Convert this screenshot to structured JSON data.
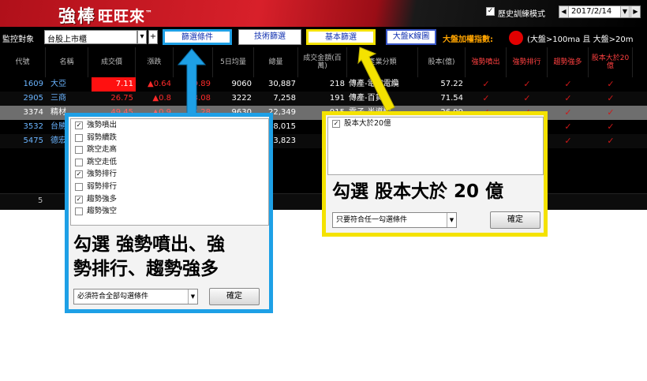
{
  "header": {
    "logo": "強棒",
    "logo_sub": "旺旺來",
    "logo_tm": "™",
    "history_mode_label": "歷史訓練模式",
    "history_mode_checked": true,
    "date": "2017/2/14",
    "prev_icon": "◀",
    "next_icon": "▶",
    "dropdown_icon": "▼"
  },
  "toolbar": {
    "monitor_label": "監控對象",
    "market_select": "台股上市櫃",
    "arrow_down": "▾",
    "plus": "+",
    "filter_btn": "篩選條件",
    "tech_btn": "技術篩選",
    "basic_btn": "基本篩選",
    "kline_btn": "大盤K線圖",
    "index_label": "大盤加權指數:",
    "condition_text": "(大盤>100ma 且 大盤>20m"
  },
  "table": {
    "headers": [
      "代號",
      "名稱",
      "成交價",
      "漲跌",
      "漲幅",
      "5日均量",
      "總量",
      "成交金額(百萬)",
      "產業分類",
      "股本(億)",
      "強勢噴出",
      "強勢排行",
      "趨勢強多",
      "股本大於20億"
    ],
    "rows": [
      {
        "code": "1609",
        "name": "大亞",
        "price": "7.11",
        "change": "▲0.64",
        "pct": "9.89",
        "avg5": "9060",
        "vol": "30,887",
        "amt": "218",
        "ind": "傳產-電線電纜",
        "cap": "57.22",
        "c1": "✓",
        "c2": "✓",
        "c3": "✓",
        "c4": "✓"
      },
      {
        "code": "2905",
        "name": "三商",
        "price": "26.75",
        "change": "▲0.8",
        "pct": "3.08",
        "avg5": "3222",
        "vol": "7,258",
        "amt": "191",
        "ind": "傳產-百貨",
        "cap": "71.54",
        "c1": "✓",
        "c2": "✓",
        "c3": "✓",
        "c4": "✓"
      },
      {
        "code": "3374",
        "name": "精材",
        "price": "49.45",
        "change": "▲0.9",
        "pct": "2.28",
        "avg5": "9630",
        "vol": "22,349",
        "amt": "915",
        "ind": "電子-半導體",
        "cap": "26.99",
        "c1": "✓",
        "c2": "✓",
        "c3": "✓",
        "c4": "✓"
      },
      {
        "code": "3532",
        "name": "台勝科",
        "price": "",
        "change": "",
        "pct": "",
        "avg5": "",
        "vol": "18,015",
        "amt": "",
        "ind": "",
        "cap": "",
        "c1": "✓",
        "c2": "✓",
        "c3": "✓",
        "c4": "✓"
      },
      {
        "code": "5475",
        "name": "德宏",
        "price": "",
        "change": "",
        "pct": "",
        "avg5": "",
        "vol": "3,823",
        "amt": "",
        "ind": "",
        "cap": "",
        "c1": "✓",
        "c2": "✓",
        "c3": "✓",
        "c4": "✓"
      }
    ],
    "row_count": "5"
  },
  "popup_left": {
    "options": [
      {
        "label": "強勢噴出",
        "checked": true
      },
      {
        "label": "弱勢續跌",
        "checked": false
      },
      {
        "label": "跳空走高",
        "checked": false
      },
      {
        "label": "跳空走低",
        "checked": false
      },
      {
        "label": "強勢排行",
        "checked": true
      },
      {
        "label": "弱勢排行",
        "checked": false
      },
      {
        "label": "趨勢強多",
        "checked": true
      },
      {
        "label": "趨勢強空",
        "checked": false
      }
    ],
    "callout_line1": "勾選 強勢噴出、強",
    "callout_line2": "勢排行、趨勢強多",
    "mode_select": "必須符合全部勾選條件",
    "confirm": "確定"
  },
  "popup_right": {
    "options": [
      {
        "label": "股本大於20億",
        "checked": true
      }
    ],
    "callout": "勾選 股本大於 20 億",
    "mode_select": "只要符合任一勾選條件",
    "confirm": "確定"
  },
  "colors": {
    "blue_highlight": "#1ea0e6",
    "yellow_highlight": "#f4e200",
    "header_red": "#c41822",
    "up_red": "#ff2a2a",
    "code_blue": "#6ab4ff"
  }
}
